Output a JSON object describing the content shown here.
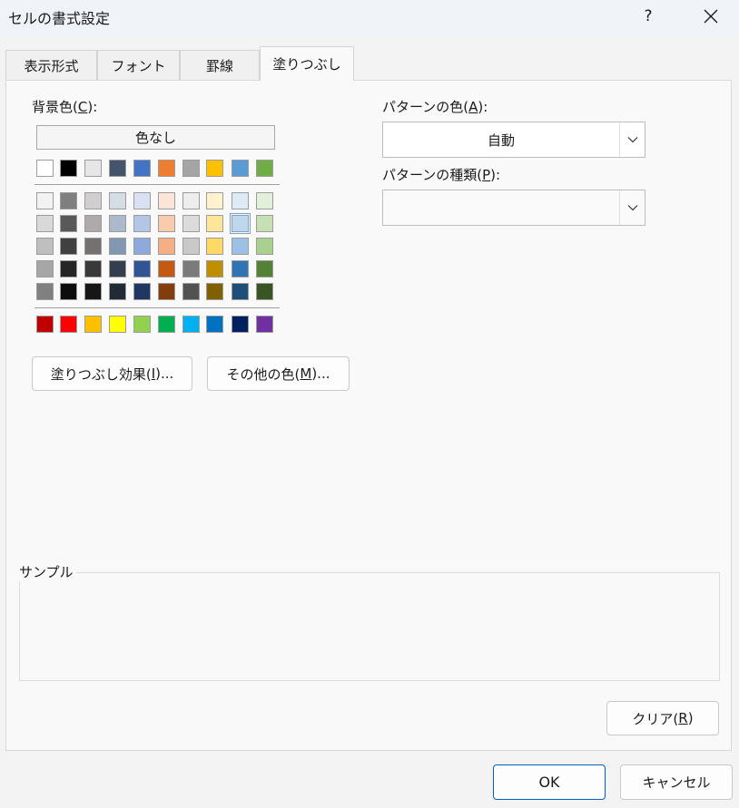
{
  "window": {
    "title": "セルの書式設定",
    "help_label": "?"
  },
  "tabs": [
    {
      "label": "表示形式"
    },
    {
      "label": "フォント"
    },
    {
      "label": "罫線"
    },
    {
      "label": "塗りつぶし"
    }
  ],
  "fill": {
    "background_label": "背景色(",
    "background_key": "C",
    "background_suffix": "):",
    "no_color_label": "色なし",
    "theme_top": [
      "#ffffff",
      "#000000",
      "#e7e6e6",
      "#44546a",
      "#4472c4",
      "#ed7d31",
      "#a5a5a5",
      "#ffc000",
      "#5b9bd5",
      "#70ad47"
    ],
    "theme_shades": [
      [
        "#f2f2f2",
        "#7f7f7f",
        "#d0cece",
        "#d6dce4",
        "#d9e1f2",
        "#fce4d6",
        "#ededed",
        "#fff2cc",
        "#ddebf7",
        "#e2efda"
      ],
      [
        "#d9d9d9",
        "#595959",
        "#aeaaaa",
        "#acb9ca",
        "#b4c6e7",
        "#f8cbad",
        "#dbdbdb",
        "#ffe699",
        "#bdd7ee",
        "#c6e0b4"
      ],
      [
        "#bfbfbf",
        "#404040",
        "#757171",
        "#8497b0",
        "#8ea9db",
        "#f4b084",
        "#c9c9c9",
        "#ffd966",
        "#9bc2e6",
        "#a9d08e"
      ],
      [
        "#a6a6a6",
        "#262626",
        "#3a3838",
        "#333f4f",
        "#305496",
        "#c65911",
        "#7b7b7b",
        "#bf8f00",
        "#2f75b5",
        "#548235"
      ],
      [
        "#808080",
        "#0d0d0d",
        "#161616",
        "#222b35",
        "#203764",
        "#833c0c",
        "#525252",
        "#806000",
        "#1f4e78",
        "#375623"
      ]
    ],
    "standard": [
      "#c00000",
      "#ff0000",
      "#ffc000",
      "#ffff00",
      "#92d050",
      "#00b050",
      "#00b0f0",
      "#0070c0",
      "#002060",
      "#7030a0"
    ],
    "selected_color": "#bdd7ee",
    "effects_label": "塗りつぶし効果(",
    "effects_key": "I",
    "effects_suffix": ")...",
    "more_colors_label": "その他の色(",
    "more_colors_key": "M",
    "more_colors_suffix": ")...",
    "pattern_color_label": "パターンの色(",
    "pattern_color_key": "A",
    "pattern_color_suffix": "):",
    "pattern_color_value": "自動",
    "pattern_style_label": "パターンの種類(",
    "pattern_style_key": "P",
    "pattern_style_suffix": "):",
    "sample_label": "サンプル",
    "clear_label": "クリア(",
    "clear_key": "R",
    "clear_suffix": ")"
  },
  "footer": {
    "ok_label": "OK",
    "cancel_label": "キャンセル"
  }
}
